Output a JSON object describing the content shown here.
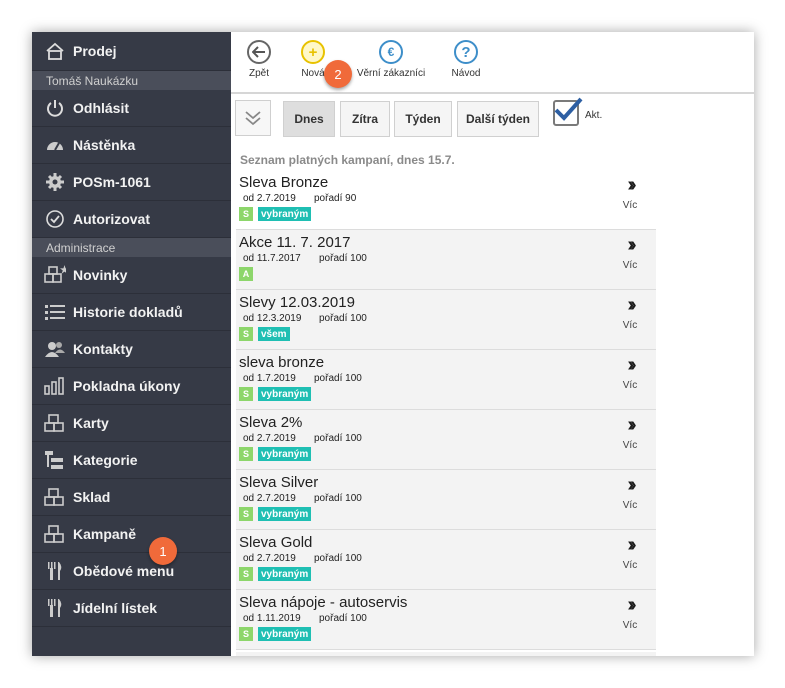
{
  "sidebar": {
    "top": {
      "label": "Prodej",
      "icon": "home-icon"
    },
    "user_name": "Tomáš Naukázku",
    "items_a": [
      {
        "label": "Odhlásit",
        "icon": "power-icon"
      },
      {
        "label": "Nástěnka",
        "icon": "dashboard-icon"
      },
      {
        "label": "POSm-1061",
        "icon": "gear-icon"
      },
      {
        "label": "Autorizovat",
        "icon": "check-circle-icon"
      }
    ],
    "section_admin": "Administrace",
    "items_b": [
      {
        "label": "Novinky",
        "icon": "news-icon"
      },
      {
        "label": "Historie dokladů",
        "icon": "list-icon"
      },
      {
        "label": "Kontakty",
        "icon": "people-icon"
      },
      {
        "label": "Pokladna úkony",
        "icon": "bar-chart-icon"
      },
      {
        "label": "Karty",
        "icon": "cards-icon"
      },
      {
        "label": "Kategorie",
        "icon": "tree-icon"
      },
      {
        "label": "Sklad",
        "icon": "boxes-icon"
      },
      {
        "label": "Kampaně",
        "icon": "campaign-icon"
      },
      {
        "label": "Obědové menu",
        "icon": "cutlery-icon"
      },
      {
        "label": "Jídelní lístek",
        "icon": "cutlery-icon"
      }
    ]
  },
  "toolbar": {
    "back": "Zpět",
    "new": "Nová",
    "loyal": "Věrní zákazníci",
    "help": "Návod"
  },
  "filters": {
    "today": "Dnes",
    "tomorrow": "Zítra",
    "week": "Týden",
    "next_week": "Další týden",
    "active_label": "Akt."
  },
  "list": {
    "title": "Seznam platných kampaní, dnes 15.7.",
    "more_label": "Víc",
    "rows": [
      {
        "name": "Sleva Bronze",
        "from": "od 2.7.2019",
        "order": "pořadí 90",
        "tag": "S",
        "group": "vybraným"
      },
      {
        "name": "Akce 11. 7. 2017",
        "from": "od 11.7.2017",
        "order": "pořadí 100",
        "tag": "A",
        "group": ""
      },
      {
        "name": "Slevy 12.03.2019",
        "from": "od 12.3.2019",
        "order": "pořadí 100",
        "tag": "S",
        "group": "všem"
      },
      {
        "name": "sleva bronze",
        "from": "od 1.7.2019",
        "order": "pořadí 100",
        "tag": "S",
        "group": "vybraným"
      },
      {
        "name": "Sleva 2%",
        "from": "od 2.7.2019",
        "order": "pořadí 100",
        "tag": "S",
        "group": "vybraným"
      },
      {
        "name": "Sleva Silver",
        "from": "od 2.7.2019",
        "order": "pořadí 100",
        "tag": "S",
        "group": "vybraným"
      },
      {
        "name": "Sleva Gold",
        "from": "od 2.7.2019",
        "order": "pořadí 100",
        "tag": "S",
        "group": "vybraným"
      },
      {
        "name": "Sleva nápoje - autoservis",
        "from": "od 1.11.2019",
        "order": "pořadí 100",
        "tag": "S",
        "group": "vybraným"
      }
    ]
  },
  "callouts": {
    "first": "1",
    "second": "2"
  },
  "colors": {
    "sidebar": "#363a46",
    "accent_orange": "#f06a3a",
    "tag_green": "#8dd66b",
    "tag_teal": "#1fbfb3"
  }
}
